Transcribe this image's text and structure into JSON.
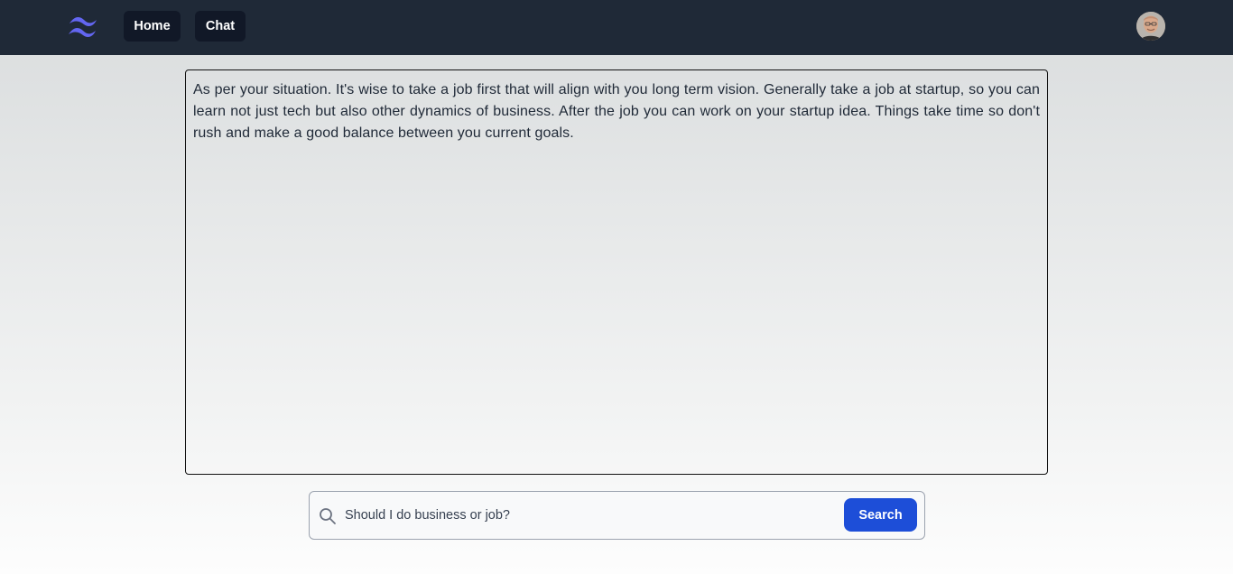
{
  "nav": {
    "logo_icon": "tailwind-wave-logo",
    "logo_color": "#6366f1",
    "home_label": "Home",
    "chat_label": "Chat",
    "avatar_icon": "user-avatar"
  },
  "response": {
    "text": "As per your situation. It's wise to take a job first that will align with you long term vision. Generally take a job at startup, so you can learn not just tech but also other dynamics of business. After the job you can work on your startup idea. Things take time so don't rush and make a good balance between you current goals."
  },
  "search": {
    "icon": "search-icon",
    "value": "Should I do business or job?",
    "button_label": "Search",
    "button_color": "#1d4ed8"
  },
  "colors": {
    "navbar_bg": "#1f2937",
    "nav_button_bg": "#111827"
  }
}
